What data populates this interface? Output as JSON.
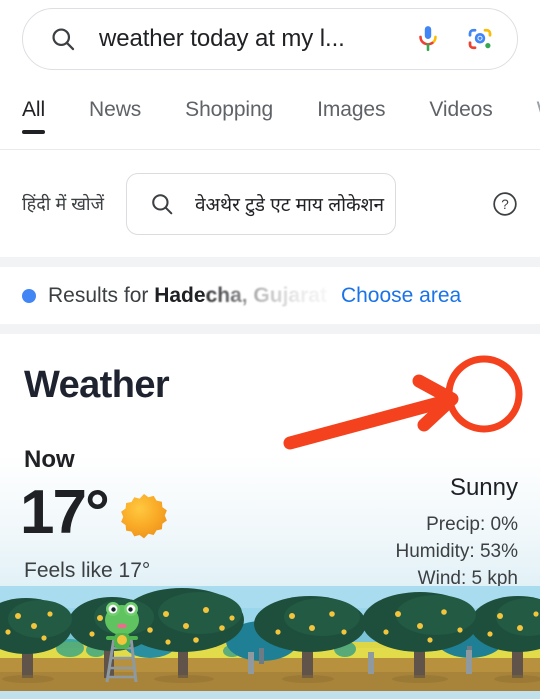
{
  "search": {
    "query": "weather today at my l...",
    "glass_icon": "search-icon",
    "mic_icon": "microphone-icon",
    "lens_icon": "google-lens-icon"
  },
  "tabs": [
    {
      "label": "All",
      "active": true
    },
    {
      "label": "News",
      "active": false
    },
    {
      "label": "Shopping",
      "active": false
    },
    {
      "label": "Images",
      "active": false
    },
    {
      "label": "Videos",
      "active": false
    },
    {
      "label": "We",
      "active": false
    }
  ],
  "translate": {
    "label": "हिंदी में खोजें",
    "query": "वेअथेर टुडे एट माय लोकेशन",
    "glass_icon": "search-icon",
    "help_icon": "help-circle-icon"
  },
  "results_bar": {
    "prefix": "Results for ",
    "location_clear": "Hade",
    "location_faded": "cha, Gujarat",
    "choose_area": "Choose area",
    "dot_color": "#4285f4",
    "link_color": "#1a73e8",
    "menu_icon": "overflow-menu-icon"
  },
  "weather": {
    "title": "Weather",
    "now_label": "Now",
    "temperature": "17°",
    "feels_like": "Feels like 17°",
    "condition": "Sunny",
    "details": [
      "Precip:  0%",
      "Humidity: 53%",
      "Wind: 5 kph"
    ],
    "sun_icon": "sun-icon",
    "menu_icon": "overflow-menu-icon"
  },
  "annotation": {
    "color": "#f4421e",
    "shape": "arrow-and-circle-highlight",
    "target": "weather-overflow-menu"
  },
  "illustration": {
    "name": "orchard-frog-scene",
    "sky_color": "#9bd7ec",
    "field_color": "#e0d246",
    "ground_color": "#b5903f",
    "tree_color": "#1f4d3f",
    "frog_color": "#5cc75c"
  }
}
